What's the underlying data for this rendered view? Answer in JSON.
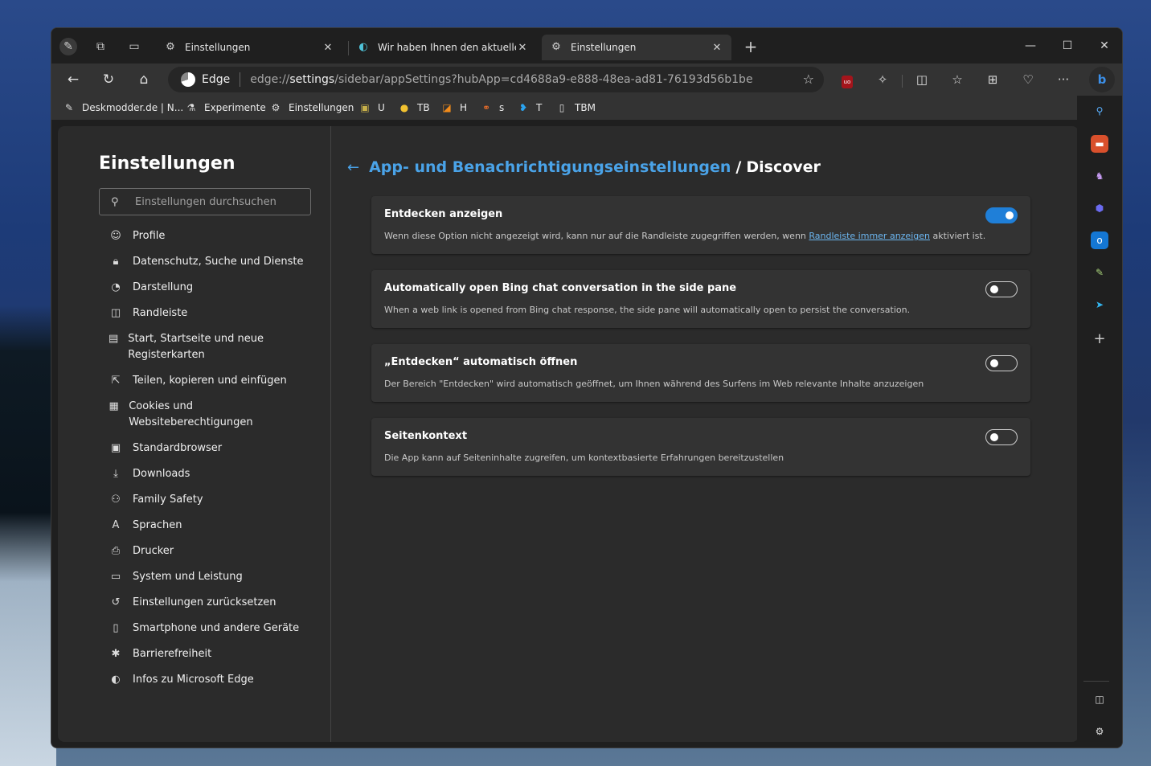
{
  "tabs": [
    {
      "title": "Einstellungen",
      "icon": "gear-icon",
      "active": false
    },
    {
      "title": "Wir haben Ihnen den aktuellen B",
      "icon": "edge-icon",
      "active": false
    },
    {
      "title": "Einstellungen",
      "icon": "gear-icon",
      "active": true
    }
  ],
  "address": {
    "edge_label": "Edge",
    "url_prefix": "edge://",
    "url_host": "settings",
    "url_path": "/sidebar/appSettings?hubApp=cd4688a9-e888-48ea-ad81-76193d56b1be"
  },
  "bookmarks": [
    {
      "label": "Deskmodder.de | N...",
      "icon": "pen-icon"
    },
    {
      "label": "Experimente",
      "icon": "flask-icon"
    },
    {
      "label": "Einstellungen",
      "icon": "gear-icon"
    },
    {
      "label": "U",
      "icon": "bookmark-u-icon"
    },
    {
      "label": "TB",
      "icon": "bookmark-tb-icon"
    },
    {
      "label": "H",
      "icon": "bookmark-h-icon"
    },
    {
      "label": "s",
      "icon": "bookmark-s-icon"
    },
    {
      "label": "T",
      "icon": "twitter-icon"
    },
    {
      "label": "TBM",
      "icon": "document-icon"
    }
  ],
  "settings": {
    "title": "Einstellungen",
    "search_placeholder": "Einstellungen durchsuchen",
    "nav": [
      {
        "label": "Profile",
        "icon": "profile-icon"
      },
      {
        "label": "Datenschutz, Suche und Dienste",
        "icon": "lock-icon"
      },
      {
        "label": "Darstellung",
        "icon": "appearance-icon"
      },
      {
        "label": "Randleiste",
        "icon": "sidebar-icon"
      },
      {
        "label": "Start, Startseite und neue Registerkarten",
        "icon": "home-tabs-icon"
      },
      {
        "label": "Teilen, kopieren und einfügen",
        "icon": "share-icon"
      },
      {
        "label": "Cookies und Websiteberechtigungen",
        "icon": "cookies-icon"
      },
      {
        "label": "Standardbrowser",
        "icon": "default-browser-icon"
      },
      {
        "label": "Downloads",
        "icon": "download-icon"
      },
      {
        "label": "Family Safety",
        "icon": "family-icon"
      },
      {
        "label": "Sprachen",
        "icon": "language-icon"
      },
      {
        "label": "Drucker",
        "icon": "printer-icon"
      },
      {
        "label": "System und Leistung",
        "icon": "laptop-icon"
      },
      {
        "label": "Einstellungen zurücksetzen",
        "icon": "reset-icon"
      },
      {
        "label": "Smartphone und andere Geräte",
        "icon": "phone-icon"
      },
      {
        "label": "Barrierefreiheit",
        "icon": "accessibility-icon"
      },
      {
        "label": "Infos zu Microsoft Edge",
        "icon": "edge-icon"
      }
    ]
  },
  "breadcrumb": {
    "parent": "App- und Benachrichtigungseinstellungen",
    "separator": "/",
    "current": "Discover"
  },
  "cards": [
    {
      "title": "Entdecken anzeigen",
      "desc_before": "Wenn diese Option nicht angezeigt wird, kann nur auf die Randleiste zugegriffen werden, wenn ",
      "desc_link": "Randleiste immer anzeigen",
      "desc_after": " aktiviert ist.",
      "on": true
    },
    {
      "title": "Automatically open Bing chat conversation in the side pane",
      "desc_before": "When a web link is opened from Bing chat response, the side pane will automatically open to persist the conversation.",
      "desc_link": "",
      "desc_after": "",
      "on": false
    },
    {
      "title": "„Entdecken“ automatisch öffnen",
      "desc_before": "Der Bereich \"Entdecken\" wird automatisch geöffnet, um Ihnen während des Surfens im Web relevante Inhalte anzuzeigen",
      "desc_link": "",
      "desc_after": "",
      "on": false
    },
    {
      "title": "Seitenkontext",
      "desc_before": "Die App kann auf Seiteninhalte zugreifen, um kontextbasierte Erfahrungen bereitzustellen",
      "desc_link": "",
      "desc_after": "",
      "on": false
    }
  ],
  "colors": {
    "accent": "#4aa3e8",
    "toggle_on": "#1f7fd8"
  }
}
